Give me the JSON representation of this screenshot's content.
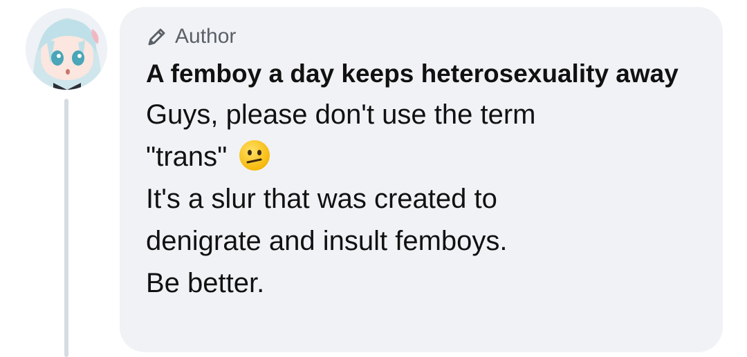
{
  "comment": {
    "badge_label": "Author",
    "author_name": "A femboy a day keeps heterosexuality away",
    "lines": [
      "Guys, please don't use the term",
      "\"trans\"",
      "It's a slur that was created to",
      "denigrate and insult femboys.",
      "Be better."
    ],
    "emoji_name": "confused-face-emoji"
  },
  "colors": {
    "bubble": "#f0f2f5",
    "badge_text": "#5b6068",
    "thread_line": "#d6dbe2"
  }
}
